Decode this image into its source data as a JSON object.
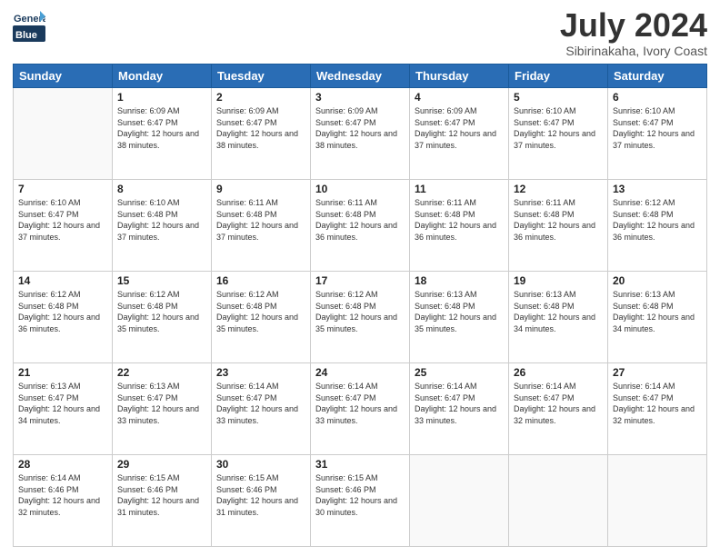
{
  "header": {
    "logo_general": "General",
    "logo_blue": "Blue",
    "month": "July 2024",
    "location": "Sibirinakaha, Ivory Coast"
  },
  "days_of_week": [
    "Sunday",
    "Monday",
    "Tuesday",
    "Wednesday",
    "Thursday",
    "Friday",
    "Saturday"
  ],
  "weeks": [
    [
      {
        "day": "",
        "sunrise": "",
        "sunset": "",
        "daylight": ""
      },
      {
        "day": "1",
        "sunrise": "Sunrise: 6:09 AM",
        "sunset": "Sunset: 6:47 PM",
        "daylight": "Daylight: 12 hours and 38 minutes."
      },
      {
        "day": "2",
        "sunrise": "Sunrise: 6:09 AM",
        "sunset": "Sunset: 6:47 PM",
        "daylight": "Daylight: 12 hours and 38 minutes."
      },
      {
        "day": "3",
        "sunrise": "Sunrise: 6:09 AM",
        "sunset": "Sunset: 6:47 PM",
        "daylight": "Daylight: 12 hours and 38 minutes."
      },
      {
        "day": "4",
        "sunrise": "Sunrise: 6:09 AM",
        "sunset": "Sunset: 6:47 PM",
        "daylight": "Daylight: 12 hours and 37 minutes."
      },
      {
        "day": "5",
        "sunrise": "Sunrise: 6:10 AM",
        "sunset": "Sunset: 6:47 PM",
        "daylight": "Daylight: 12 hours and 37 minutes."
      },
      {
        "day": "6",
        "sunrise": "Sunrise: 6:10 AM",
        "sunset": "Sunset: 6:47 PM",
        "daylight": "Daylight: 12 hours and 37 minutes."
      }
    ],
    [
      {
        "day": "7",
        "sunrise": "Sunrise: 6:10 AM",
        "sunset": "Sunset: 6:47 PM",
        "daylight": "Daylight: 12 hours and 37 minutes."
      },
      {
        "day": "8",
        "sunrise": "Sunrise: 6:10 AM",
        "sunset": "Sunset: 6:48 PM",
        "daylight": "Daylight: 12 hours and 37 minutes."
      },
      {
        "day": "9",
        "sunrise": "Sunrise: 6:11 AM",
        "sunset": "Sunset: 6:48 PM",
        "daylight": "Daylight: 12 hours and 37 minutes."
      },
      {
        "day": "10",
        "sunrise": "Sunrise: 6:11 AM",
        "sunset": "Sunset: 6:48 PM",
        "daylight": "Daylight: 12 hours and 36 minutes."
      },
      {
        "day": "11",
        "sunrise": "Sunrise: 6:11 AM",
        "sunset": "Sunset: 6:48 PM",
        "daylight": "Daylight: 12 hours and 36 minutes."
      },
      {
        "day": "12",
        "sunrise": "Sunrise: 6:11 AM",
        "sunset": "Sunset: 6:48 PM",
        "daylight": "Daylight: 12 hours and 36 minutes."
      },
      {
        "day": "13",
        "sunrise": "Sunrise: 6:12 AM",
        "sunset": "Sunset: 6:48 PM",
        "daylight": "Daylight: 12 hours and 36 minutes."
      }
    ],
    [
      {
        "day": "14",
        "sunrise": "Sunrise: 6:12 AM",
        "sunset": "Sunset: 6:48 PM",
        "daylight": "Daylight: 12 hours and 36 minutes."
      },
      {
        "day": "15",
        "sunrise": "Sunrise: 6:12 AM",
        "sunset": "Sunset: 6:48 PM",
        "daylight": "Daylight: 12 hours and 35 minutes."
      },
      {
        "day": "16",
        "sunrise": "Sunrise: 6:12 AM",
        "sunset": "Sunset: 6:48 PM",
        "daylight": "Daylight: 12 hours and 35 minutes."
      },
      {
        "day": "17",
        "sunrise": "Sunrise: 6:12 AM",
        "sunset": "Sunset: 6:48 PM",
        "daylight": "Daylight: 12 hours and 35 minutes."
      },
      {
        "day": "18",
        "sunrise": "Sunrise: 6:13 AM",
        "sunset": "Sunset: 6:48 PM",
        "daylight": "Daylight: 12 hours and 35 minutes."
      },
      {
        "day": "19",
        "sunrise": "Sunrise: 6:13 AM",
        "sunset": "Sunset: 6:48 PM",
        "daylight": "Daylight: 12 hours and 34 minutes."
      },
      {
        "day": "20",
        "sunrise": "Sunrise: 6:13 AM",
        "sunset": "Sunset: 6:48 PM",
        "daylight": "Daylight: 12 hours and 34 minutes."
      }
    ],
    [
      {
        "day": "21",
        "sunrise": "Sunrise: 6:13 AM",
        "sunset": "Sunset: 6:47 PM",
        "daylight": "Daylight: 12 hours and 34 minutes."
      },
      {
        "day": "22",
        "sunrise": "Sunrise: 6:13 AM",
        "sunset": "Sunset: 6:47 PM",
        "daylight": "Daylight: 12 hours and 33 minutes."
      },
      {
        "day": "23",
        "sunrise": "Sunrise: 6:14 AM",
        "sunset": "Sunset: 6:47 PM",
        "daylight": "Daylight: 12 hours and 33 minutes."
      },
      {
        "day": "24",
        "sunrise": "Sunrise: 6:14 AM",
        "sunset": "Sunset: 6:47 PM",
        "daylight": "Daylight: 12 hours and 33 minutes."
      },
      {
        "day": "25",
        "sunrise": "Sunrise: 6:14 AM",
        "sunset": "Sunset: 6:47 PM",
        "daylight": "Daylight: 12 hours and 33 minutes."
      },
      {
        "day": "26",
        "sunrise": "Sunrise: 6:14 AM",
        "sunset": "Sunset: 6:47 PM",
        "daylight": "Daylight: 12 hours and 32 minutes."
      },
      {
        "day": "27",
        "sunrise": "Sunrise: 6:14 AM",
        "sunset": "Sunset: 6:47 PM",
        "daylight": "Daylight: 12 hours and 32 minutes."
      }
    ],
    [
      {
        "day": "28",
        "sunrise": "Sunrise: 6:14 AM",
        "sunset": "Sunset: 6:46 PM",
        "daylight": "Daylight: 12 hours and 32 minutes."
      },
      {
        "day": "29",
        "sunrise": "Sunrise: 6:15 AM",
        "sunset": "Sunset: 6:46 PM",
        "daylight": "Daylight: 12 hours and 31 minutes."
      },
      {
        "day": "30",
        "sunrise": "Sunrise: 6:15 AM",
        "sunset": "Sunset: 6:46 PM",
        "daylight": "Daylight: 12 hours and 31 minutes."
      },
      {
        "day": "31",
        "sunrise": "Sunrise: 6:15 AM",
        "sunset": "Sunset: 6:46 PM",
        "daylight": "Daylight: 12 hours and 30 minutes."
      },
      {
        "day": "",
        "sunrise": "",
        "sunset": "",
        "daylight": ""
      },
      {
        "day": "",
        "sunrise": "",
        "sunset": "",
        "daylight": ""
      },
      {
        "day": "",
        "sunrise": "",
        "sunset": "",
        "daylight": ""
      }
    ]
  ]
}
